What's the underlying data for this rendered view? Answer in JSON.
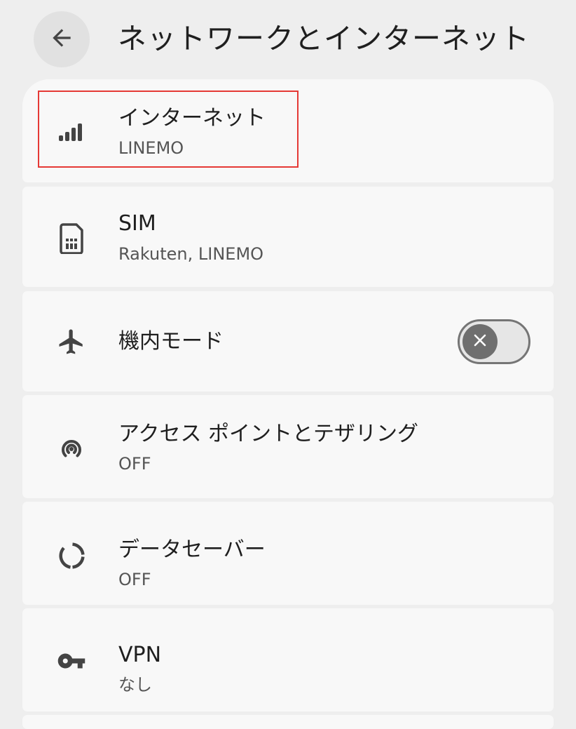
{
  "header": {
    "back_icon": "arrow-back-icon",
    "title": "ネットワークとインターネット"
  },
  "colors": {
    "background": "#eeeeee",
    "card": "#f8f8f8",
    "highlight_border": "#e53935",
    "toggle_off": "#6f6f6f"
  },
  "items": [
    {
      "icon": "signal-bars-icon",
      "title": "インターネット",
      "subtitle": "LINEMO"
    },
    {
      "icon": "sim-card-icon",
      "title": "SIM",
      "subtitle": "Rakuten, LINEMO"
    },
    {
      "icon": "airplane-icon",
      "title": "機内モード",
      "toggle": {
        "state": "off",
        "icon": "close-icon"
      }
    },
    {
      "icon": "hotspot-icon",
      "title": "アクセス ポイントとテザリング",
      "subtitle": "OFF"
    },
    {
      "icon": "data-saver-icon",
      "title": "データセーバー",
      "subtitle": "OFF"
    },
    {
      "icon": "key-icon",
      "title": "VPN",
      "subtitle": "なし"
    }
  ]
}
